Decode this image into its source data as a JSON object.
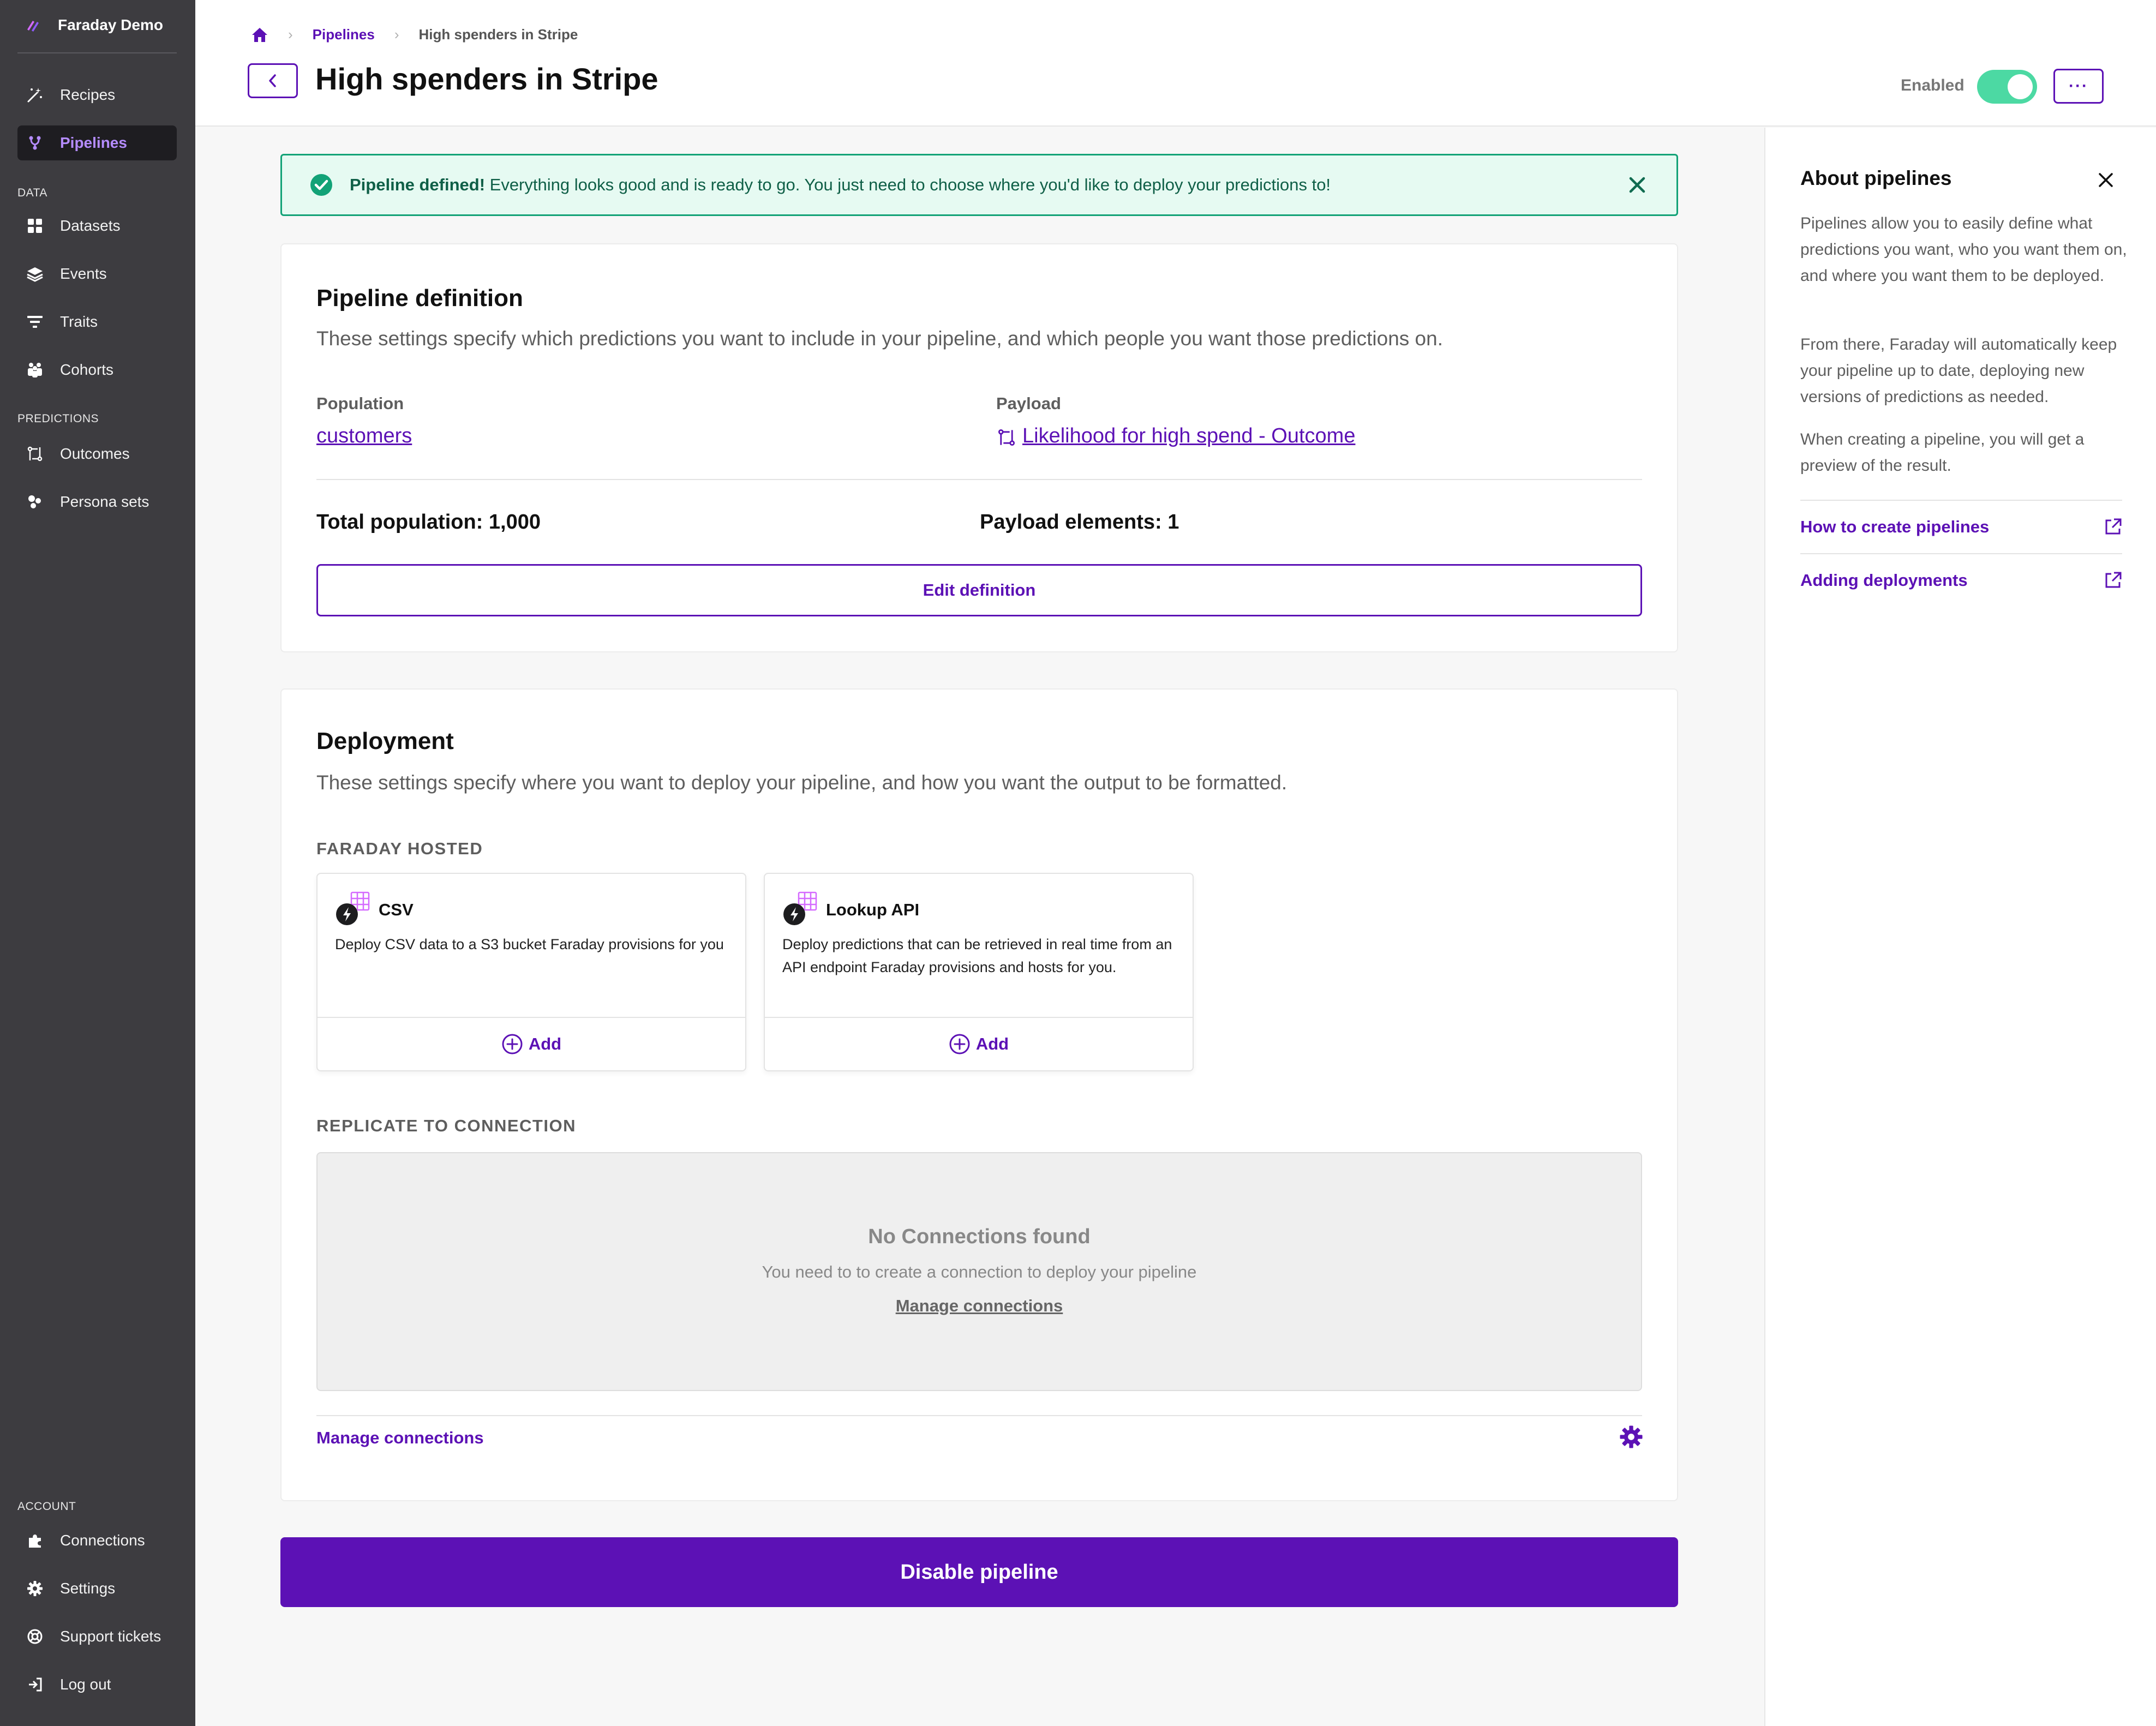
{
  "app": {
    "name": "Faraday Demo"
  },
  "sidebar": {
    "items": [
      {
        "label": "Recipes",
        "icon": "magic-wand-icon"
      },
      {
        "label": "Pipelines",
        "icon": "pipeline-icon",
        "active": true
      }
    ],
    "data_section": "DATA",
    "data_items": [
      {
        "label": "Datasets",
        "icon": "grid-icon"
      },
      {
        "label": "Events",
        "icon": "layers-icon"
      },
      {
        "label": "Traits",
        "icon": "filter-icon"
      },
      {
        "label": "Cohorts",
        "icon": "people-icon"
      }
    ],
    "predictions_section": "PREDICTIONS",
    "prediction_items": [
      {
        "label": "Outcomes",
        "icon": "outcome-icon"
      },
      {
        "label": "Persona sets",
        "icon": "persona-icon"
      }
    ],
    "account_section": "ACCOUNT",
    "account_items": [
      {
        "label": "Connections",
        "icon": "puzzle-icon"
      },
      {
        "label": "Settings",
        "icon": "gear-icon"
      },
      {
        "label": "Support tickets",
        "icon": "lifebuoy-icon"
      },
      {
        "label": "Log out",
        "icon": "logout-icon"
      }
    ]
  },
  "header": {
    "breadcrumb": {
      "link": "Pipelines",
      "current": "High spenders in Stripe"
    },
    "title": "High spenders in Stripe",
    "enabled_label": "Enabled",
    "enabled": true,
    "more_label": "···"
  },
  "alert": {
    "bold": "Pipeline defined!",
    "text": " Everything looks good and is ready to go. You just need to choose where you'd like to deploy your predictions to!"
  },
  "definition": {
    "title": "Pipeline definition",
    "desc": "These settings specify which predictions you want to include in your pipeline, and which people you want those predictions on.",
    "population_label": "Population",
    "population_value": "customers",
    "payload_label": "Payload",
    "payload_value": "Likelihood for high spend - Outcome",
    "total_population": "Total population: 1,000",
    "payload_elements": "Payload elements: 1",
    "edit_button": "Edit definition"
  },
  "deployment": {
    "title": "Deployment",
    "desc": "These settings specify where you want to deploy your pipeline, and how you want the output to be formatted.",
    "hosted_heading": "FARADAY HOSTED",
    "tiles": [
      {
        "name": "CSV",
        "desc": "Deploy CSV data to a S3 bucket Faraday provisions for you",
        "add": "Add"
      },
      {
        "name": "Lookup API",
        "desc": "Deploy predictions that can be retrieved in real time from an API endpoint Faraday provisions and hosts for you.",
        "add": "Add"
      }
    ],
    "replicate_heading": "REPLICATE TO CONNECTION",
    "empty_title": "No Connections found",
    "empty_desc": "You need to to create a connection to deploy your pipeline",
    "empty_link": "Manage connections",
    "manage_link": "Manage connections"
  },
  "disable_button": "Disable pipeline",
  "right_panel": {
    "title": "About pipelines",
    "paragraphs": [
      "Pipelines allow you to easily define what predictions you want, who you want them on, and where you want them to be deployed.",
      "From there, Faraday will automatically keep your pipeline up to date, deploying new versions of predictions as needed.",
      "When creating a pipeline, you will get a preview of the result."
    ],
    "links": [
      "How to create pipelines",
      "Adding deployments"
    ]
  },
  "colors": {
    "accent": "#5c11b5",
    "success": "#12a277",
    "toggle": "#4cd9a3",
    "sidebar": "#3d3c40"
  }
}
